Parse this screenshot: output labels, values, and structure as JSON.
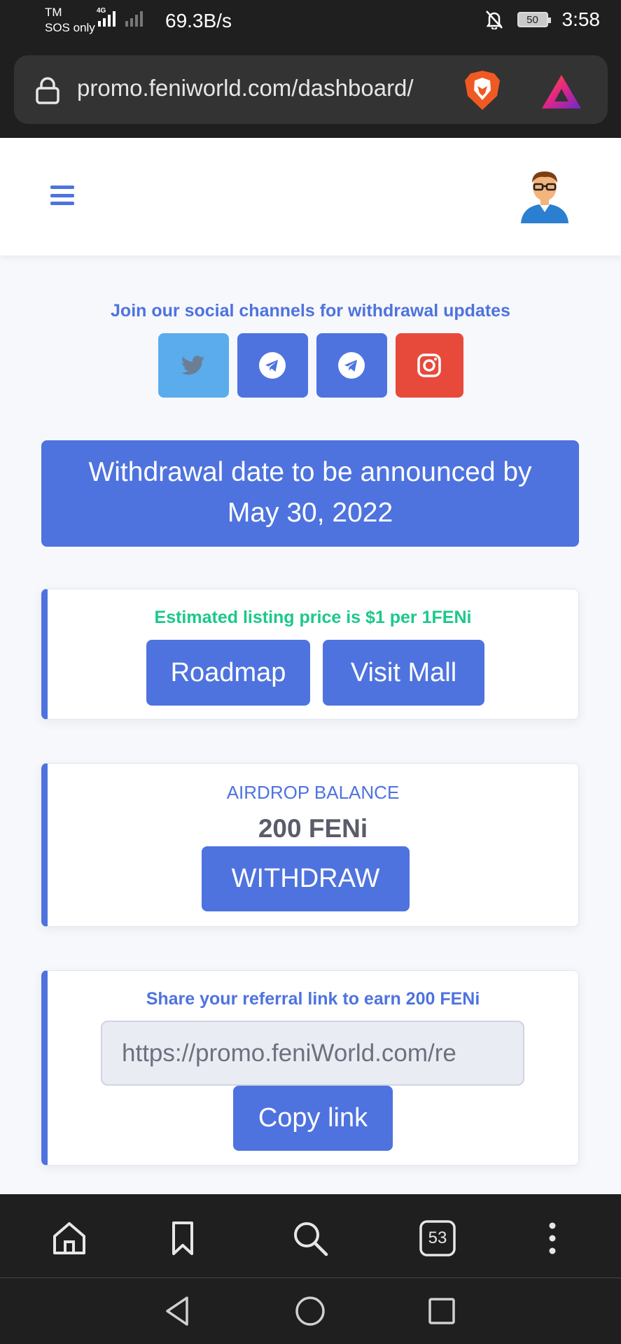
{
  "status_bar": {
    "carrier_line1": "TM",
    "carrier_line2": "SOS only",
    "network_tag": "4G",
    "speed": "69.3B/s",
    "battery": "50",
    "time": "3:58"
  },
  "browser": {
    "url": "promo.feniworld.com/dashboard/",
    "tab_count": "53"
  },
  "social": {
    "title": "Join our social channels for withdrawal updates",
    "channels": [
      "twitter-icon",
      "telegram-icon",
      "telegram-icon",
      "instagram-icon"
    ]
  },
  "banner": {
    "line1": "Withdrawal date to be announced by",
    "line2": "May 30, 2022"
  },
  "listing_card": {
    "text": "Estimated listing price is $1 per 1FENi",
    "roadmap_label": "Roadmap",
    "mall_label": "Visit Mall"
  },
  "airdrop_card": {
    "label": "AIRDROP BALANCE",
    "value": "200 FENi",
    "withdraw_label": "WITHDRAW"
  },
  "referral_card": {
    "label": "Share your referral link to earn 200 FENi",
    "link_value": "https://promo.feniWorld.com/re",
    "copy_label": "Copy link"
  },
  "colors": {
    "primary": "#4e73df",
    "success": "#1cc88a",
    "twitter": "#5aaced",
    "instagram": "#e74a3b",
    "chrome_dark": "#1f1f1f"
  }
}
